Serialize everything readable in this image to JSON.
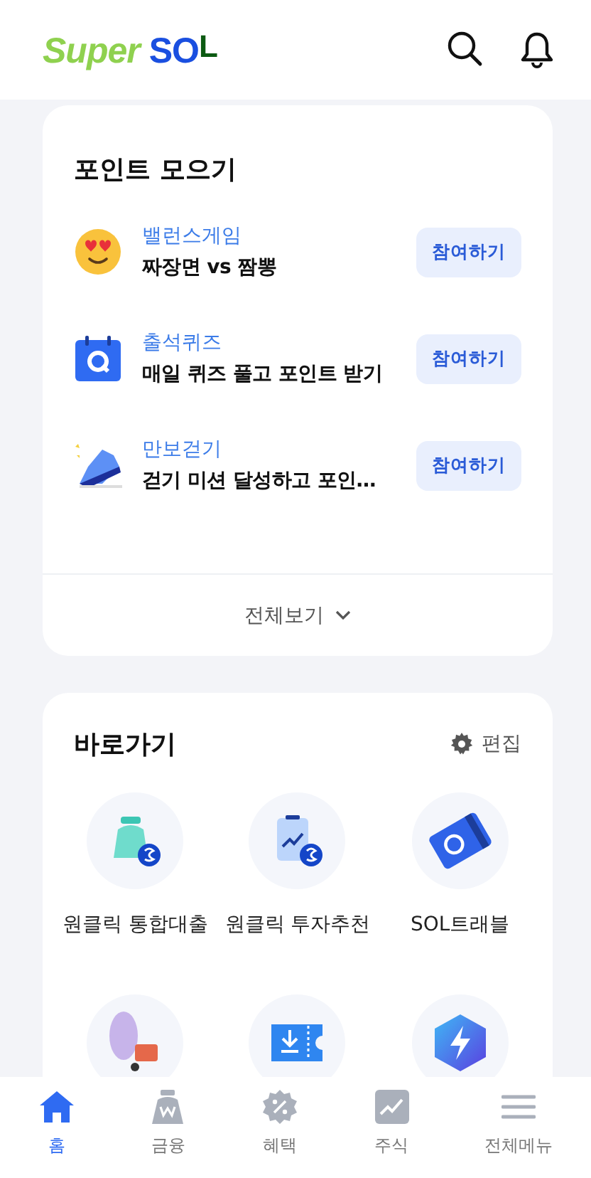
{
  "header": {
    "logo": [
      "Super",
      "SO",
      "L"
    ]
  },
  "points": {
    "title": "포인트 모으기",
    "items": [
      {
        "kind": "emoji",
        "category": "밸런스게임",
        "text": "짜장면 vs 짬뽕",
        "button": "참여하기"
      },
      {
        "kind": "calendar",
        "category": "출석퀴즈",
        "text": "매일 퀴즈 풀고 포인트 받기",
        "button": "참여하기"
      },
      {
        "kind": "shoe",
        "category": "만보걷기",
        "text": "걷기 미션 달성하고 포인…",
        "button": "참여하기"
      }
    ],
    "more": "전체보기"
  },
  "shortcuts": {
    "title": "바로가기",
    "edit": "편집",
    "items": [
      {
        "kind": "loan",
        "label": "원클릭 통합대출"
      },
      {
        "kind": "invest",
        "label": "원클릭 투자추천"
      },
      {
        "kind": "travel",
        "label": "SOL트래블"
      },
      {
        "kind": "character"
      },
      {
        "kind": "coupon"
      },
      {
        "kind": "badge"
      }
    ]
  },
  "nav": [
    {
      "kind": "home",
      "label": "홈",
      "selected": true
    },
    {
      "kind": "finance",
      "label": "금융",
      "selected": false
    },
    {
      "kind": "benefit",
      "label": "혜택",
      "selected": false
    },
    {
      "kind": "stock",
      "label": "주식",
      "selected": false
    },
    {
      "kind": "menu",
      "label": "전체메뉴",
      "selected": false
    }
  ]
}
